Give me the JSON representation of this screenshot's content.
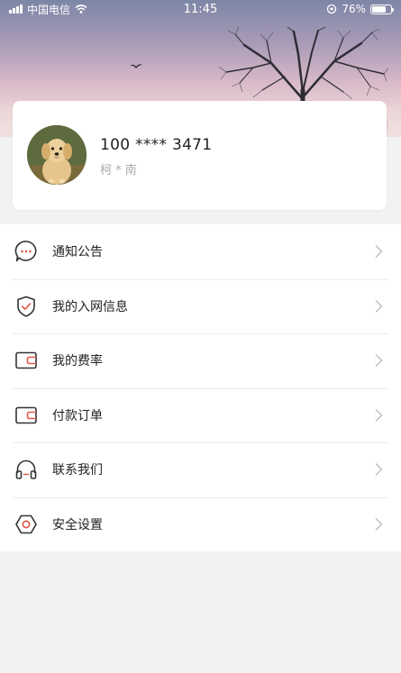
{
  "status_bar": {
    "carrier": "中国电信",
    "time": "11:45",
    "battery": "76%",
    "battery_level": 0.76
  },
  "profile": {
    "phone": "100 **** 3471",
    "name": "柯 * 南",
    "avatar_icon": "golden-retriever-avatar"
  },
  "menu": {
    "items": [
      {
        "label": "通知公告",
        "icon": "chat-bubble-icon"
      },
      {
        "label": "我的入网信息",
        "icon": "shield-check-icon"
      },
      {
        "label": "我的费率",
        "icon": "wallet-icon"
      },
      {
        "label": "付款订单",
        "icon": "wallet-icon"
      },
      {
        "label": "联系我们",
        "icon": "headset-icon"
      },
      {
        "label": "安全设置",
        "icon": "hexagon-gear-icon"
      }
    ]
  },
  "colors": {
    "accent": "#e05a4a",
    "icon_stroke": "#333333",
    "background": "#f2f2f2"
  }
}
